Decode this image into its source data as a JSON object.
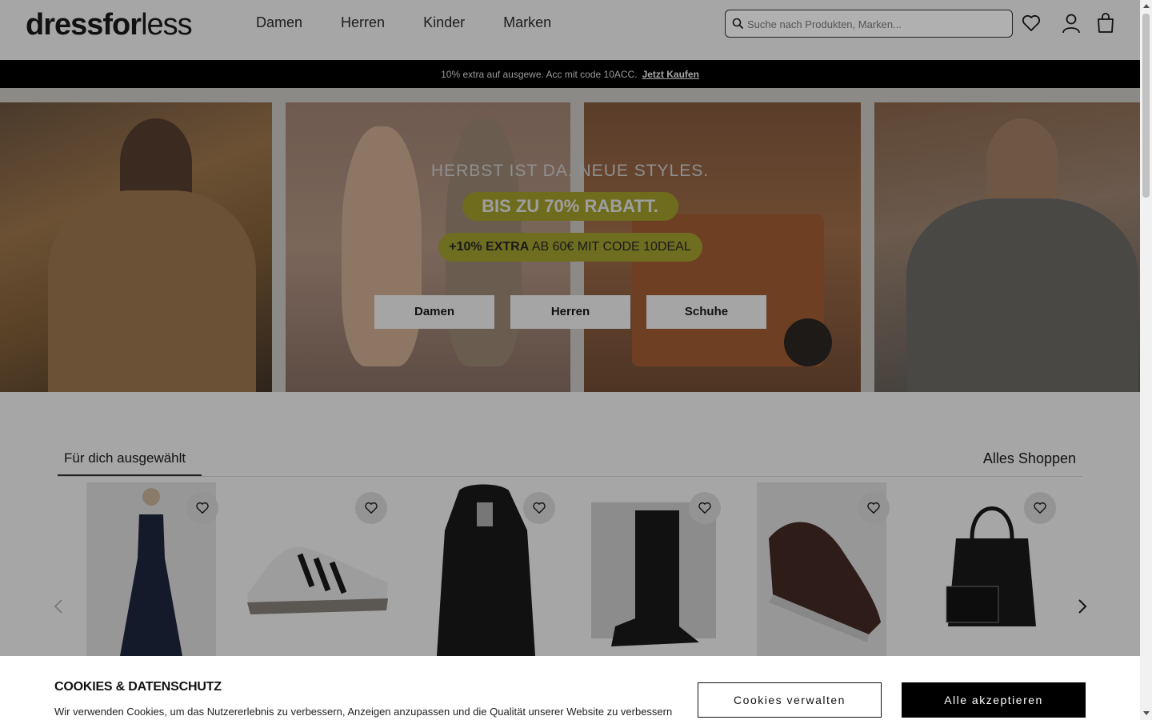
{
  "header": {
    "logo_bold": "dressfor",
    "logo_thin": "less",
    "nav": [
      "Damen",
      "Herren",
      "Kinder",
      "Marken"
    ],
    "search_placeholder": "Suche nach Produkten, Marken...",
    "icons": [
      "search-icon",
      "heart-icon",
      "user-icon",
      "bag-icon"
    ]
  },
  "promo": {
    "text": "10% extra auf ausgewe. Acc mit code 10ACC.",
    "link": "Jetzt Kaufen"
  },
  "hero": {
    "headline": "HERBST IST DA. NEUE STYLES.",
    "discount": "BIS ZU 70% RABATT.",
    "extra_bold": "+10% EXTRA",
    "extra_rest": " AB 60€ MIT CODE 10DEAL",
    "buttons": [
      "Damen",
      "Herren",
      "Schuhe"
    ]
  },
  "section": {
    "tab": "Für dich ausgewählt",
    "all_link": "Alles Shoppen",
    "products": [
      "dress",
      "sneaker",
      "coat",
      "rain-boot",
      "sneaker-brown",
      "handbag"
    ]
  },
  "cookie": {
    "title": "COOKIES & DATENSCHUTZ",
    "text": "Wir verwenden Cookies, um das Nutzererlebnis zu verbessern, Anzeigen anzupassen und die Qualität unserer Website zu verbessern",
    "manage": "Cookies verwalten",
    "accept": "Alle akzeptieren"
  },
  "colors": {
    "overlay_gray": "#a6a6a6",
    "promo_bg": "#000000",
    "pill": "#6f6c1e",
    "accept_bg": "#000000"
  }
}
